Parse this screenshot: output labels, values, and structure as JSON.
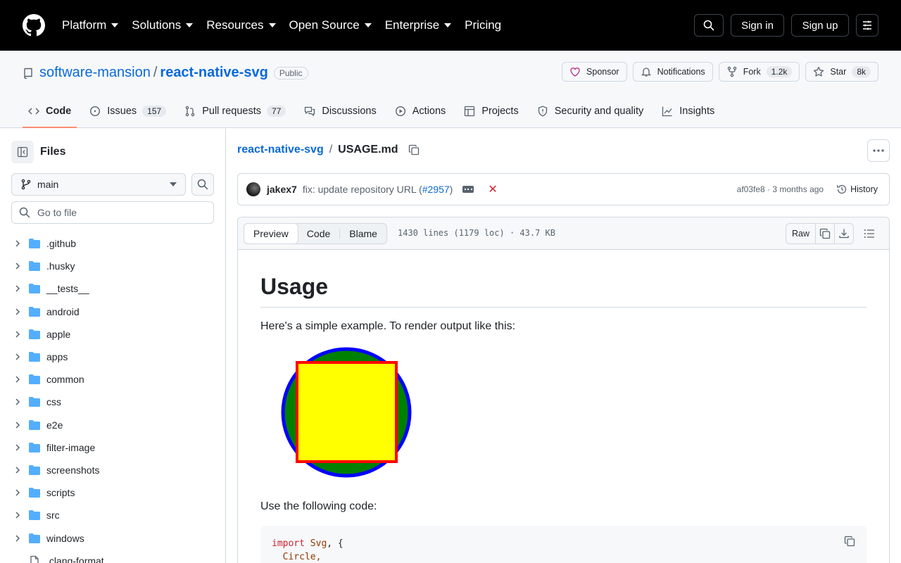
{
  "nav": {
    "items": [
      "Platform",
      "Solutions",
      "Resources",
      "Open Source",
      "Enterprise",
      "Pricing"
    ],
    "sign_in": "Sign in",
    "sign_up": "Sign up"
  },
  "repo": {
    "owner": "software-mansion",
    "name": "react-native-svg",
    "visibility": "Public",
    "sponsor": "Sponsor",
    "notifications": "Notifications",
    "fork": "Fork",
    "fork_count": "1.2k",
    "star": "Star",
    "star_count": "8k"
  },
  "tabs": [
    {
      "label": "Code",
      "count": ""
    },
    {
      "label": "Issues",
      "count": "157"
    },
    {
      "label": "Pull requests",
      "count": "77"
    },
    {
      "label": "Discussions",
      "count": ""
    },
    {
      "label": "Actions",
      "count": ""
    },
    {
      "label": "Projects",
      "count": ""
    },
    {
      "label": "Security and quality",
      "count": ""
    },
    {
      "label": "Insights",
      "count": ""
    }
  ],
  "sidebar": {
    "title": "Files",
    "branch": "main",
    "goto_placeholder": "Go to file",
    "folders": [
      ".github",
      ".husky",
      "__tests__",
      "android",
      "apple",
      "apps",
      "common",
      "css",
      "e2e",
      "filter-image",
      "screenshots",
      "scripts",
      "src",
      "windows"
    ],
    "file": ".clang-format"
  },
  "breadcrumb": {
    "repo": "react-native-svg",
    "separator": "/",
    "file": "USAGE.md"
  },
  "commit": {
    "author": "jakex7",
    "message": "fix: update repository URL (",
    "pr": "#2957",
    "message_end": ")",
    "sha": "af03fe8",
    "time": "3 months ago",
    "history": "History"
  },
  "file_view": {
    "tabs": [
      "Preview",
      "Code",
      "Blame"
    ],
    "meta": "1430 lines (1179 loc) · 43.7 KB",
    "raw": "Raw"
  },
  "readme": {
    "heading": "Usage",
    "intro": "Here's a simple example. To render output like this:",
    "code_intro": "Use the following code:",
    "code_line1_kw": "import",
    "code_line1_name": "Svg",
    "code_line1_rest": ", {",
    "code_line2": "Circle,"
  },
  "colors": {
    "accent": "#0969da",
    "tab_underline": "#fd8c73",
    "demo_circle_fill": "#008000",
    "demo_circle_stroke": "#0000ff",
    "demo_rect_fill": "#ffff00",
    "demo_rect_stroke": "#ff0000"
  }
}
